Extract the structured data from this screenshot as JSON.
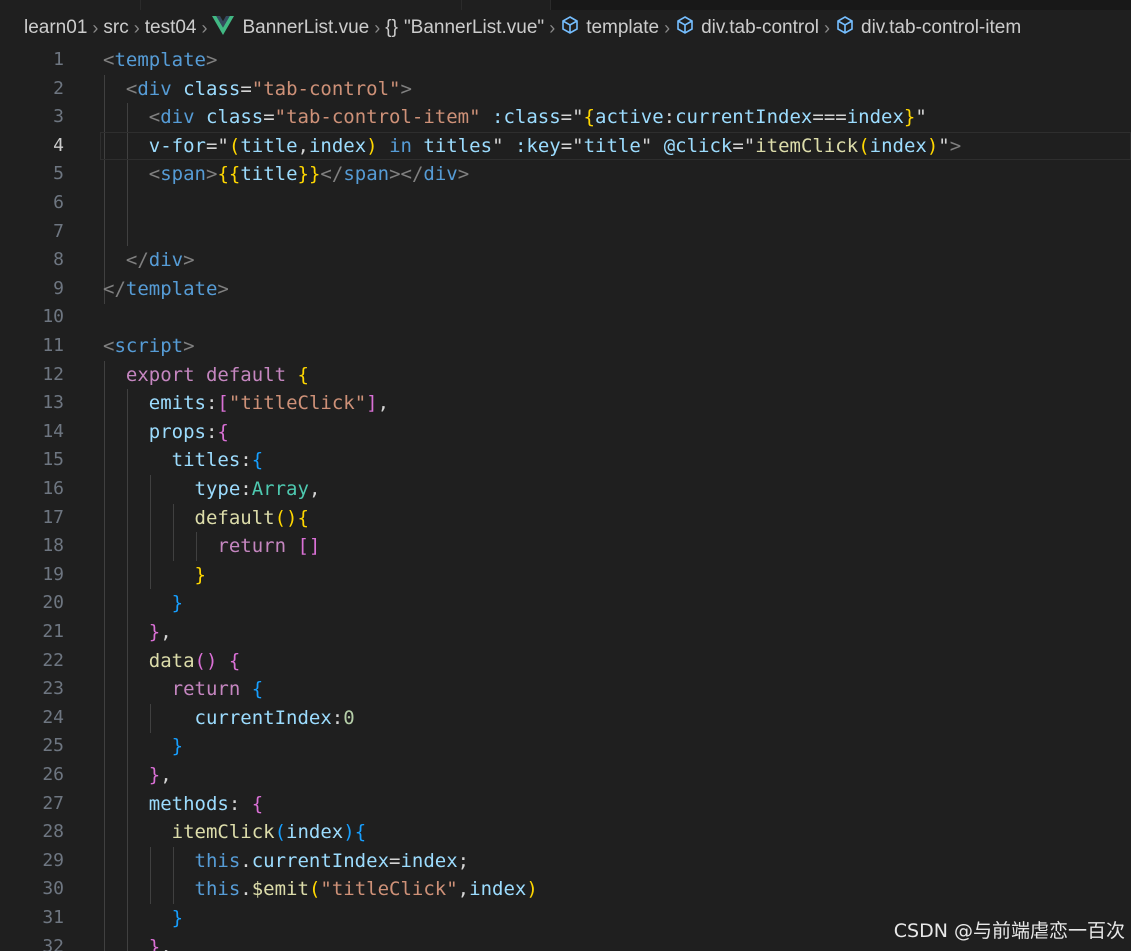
{
  "breadcrumb": {
    "items": [
      {
        "label": "learn01",
        "icon": ""
      },
      {
        "label": "src",
        "icon": ""
      },
      {
        "label": "test04",
        "icon": ""
      },
      {
        "label": "BannerList.vue",
        "icon": "vue-icon"
      },
      {
        "label": "\"BannerList.vue\"",
        "icon": "braces-icon"
      },
      {
        "label": "template",
        "icon": "cube-icon"
      },
      {
        "label": "div.tab-control",
        "icon": "cube-icon"
      },
      {
        "label": "div.tab-control-item",
        "icon": "cube-icon"
      }
    ],
    "vue_color": "#41b883",
    "cube_color": "#75beff"
  },
  "editor": {
    "active_line": 4,
    "lines": [
      {
        "n": "1",
        "tokens": [
          [
            "b",
            "<"
          ],
          [
            "tag",
            "template"
          ],
          [
            "b",
            ">"
          ]
        ]
      },
      {
        "n": "2",
        "tokens": [
          [
            "p",
            "  "
          ],
          [
            "b",
            "<"
          ],
          [
            "tag",
            "div"
          ],
          [
            "p",
            " "
          ],
          [
            "attr",
            "class"
          ],
          [
            "p",
            "="
          ],
          [
            "str",
            "\"tab-control\""
          ],
          [
            "b",
            ">"
          ]
        ]
      },
      {
        "n": "3",
        "tokens": [
          [
            "p",
            "    "
          ],
          [
            "b",
            "<"
          ],
          [
            "tag",
            "div"
          ],
          [
            "p",
            " "
          ],
          [
            "attr",
            "class"
          ],
          [
            "p",
            "="
          ],
          [
            "str",
            "\"tab-control-item\""
          ],
          [
            "p",
            " "
          ],
          [
            "attr",
            ":class"
          ],
          [
            "p",
            "=\""
          ],
          [
            "b1",
            "{"
          ],
          [
            "prop",
            "active"
          ],
          [
            "p",
            ":"
          ],
          [
            "prop",
            "currentIndex"
          ],
          [
            "p",
            "==="
          ],
          [
            "prop",
            "index"
          ],
          [
            "b1",
            "}"
          ],
          [
            "p",
            "\""
          ]
        ]
      },
      {
        "n": "4",
        "tokens": [
          [
            "p",
            "    "
          ],
          [
            "attr",
            "v-for"
          ],
          [
            "p",
            "=\""
          ],
          [
            "b1",
            "("
          ],
          [
            "prop",
            "title"
          ],
          [
            "p",
            ","
          ],
          [
            "prop",
            "index"
          ],
          [
            "b1",
            ")"
          ],
          [
            "p",
            " "
          ],
          [
            "thisvar",
            "in"
          ],
          [
            "p",
            " "
          ],
          [
            "prop",
            "titles"
          ],
          [
            "p",
            "\" "
          ],
          [
            "attr",
            ":key"
          ],
          [
            "p",
            "=\""
          ],
          [
            "prop",
            "title"
          ],
          [
            "p",
            "\" "
          ],
          [
            "attr",
            "@click"
          ],
          [
            "p",
            "=\""
          ],
          [
            "fn",
            "itemClick"
          ],
          [
            "b1",
            "("
          ],
          [
            "prop",
            "index"
          ],
          [
            "b1",
            ")"
          ],
          [
            "p",
            "\""
          ],
          [
            "b",
            ">"
          ]
        ]
      },
      {
        "n": "5",
        "tokens": [
          [
            "p",
            "    "
          ],
          [
            "b",
            "<"
          ],
          [
            "tag",
            "span"
          ],
          [
            "b",
            ">"
          ],
          [
            "b1",
            "{{"
          ],
          [
            "prop",
            "title"
          ],
          [
            "b1",
            "}}"
          ],
          [
            "b",
            "</"
          ],
          [
            "tag",
            "span"
          ],
          [
            "b",
            "></"
          ],
          [
            "tag",
            "div"
          ],
          [
            "b",
            ">"
          ]
        ]
      },
      {
        "n": "6",
        "tokens": []
      },
      {
        "n": "7",
        "tokens": []
      },
      {
        "n": "8",
        "tokens": [
          [
            "p",
            "  "
          ],
          [
            "b",
            "</"
          ],
          [
            "tag",
            "div"
          ],
          [
            "b",
            ">"
          ]
        ]
      },
      {
        "n": "9",
        "tokens": [
          [
            "b",
            "</"
          ],
          [
            "tag",
            "template"
          ],
          [
            "b",
            ">"
          ]
        ]
      },
      {
        "n": "10",
        "tokens": []
      },
      {
        "n": "11",
        "tokens": [
          [
            "b",
            "<"
          ],
          [
            "tag",
            "script"
          ],
          [
            "b",
            ">"
          ]
        ]
      },
      {
        "n": "12",
        "tokens": [
          [
            "p",
            "  "
          ],
          [
            "kw",
            "export"
          ],
          [
            "p",
            " "
          ],
          [
            "kw",
            "default"
          ],
          [
            "p",
            " "
          ],
          [
            "b1",
            "{"
          ]
        ]
      },
      {
        "n": "13",
        "tokens": [
          [
            "p",
            "    "
          ],
          [
            "prop",
            "emits"
          ],
          [
            "p",
            ":"
          ],
          [
            "b2",
            "["
          ],
          [
            "str",
            "\"titleClick\""
          ],
          [
            "b2",
            "]"
          ],
          [
            "p",
            ","
          ]
        ]
      },
      {
        "n": "14",
        "tokens": [
          [
            "p",
            "    "
          ],
          [
            "prop",
            "props"
          ],
          [
            "p",
            ":"
          ],
          [
            "b2",
            "{"
          ]
        ]
      },
      {
        "n": "15",
        "tokens": [
          [
            "p",
            "      "
          ],
          [
            "prop",
            "titles"
          ],
          [
            "p",
            ":"
          ],
          [
            "b3",
            "{"
          ]
        ]
      },
      {
        "n": "16",
        "tokens": [
          [
            "p",
            "        "
          ],
          [
            "prop",
            "type"
          ],
          [
            "p",
            ":"
          ],
          [
            "type",
            "Array"
          ],
          [
            "p",
            ","
          ]
        ]
      },
      {
        "n": "17",
        "tokens": [
          [
            "p",
            "        "
          ],
          [
            "fn",
            "default"
          ],
          [
            "b1",
            "()"
          ],
          [
            "b1",
            "{"
          ]
        ]
      },
      {
        "n": "18",
        "tokens": [
          [
            "p",
            "          "
          ],
          [
            "kw",
            "return"
          ],
          [
            "p",
            " "
          ],
          [
            "b2",
            "[]"
          ]
        ]
      },
      {
        "n": "19",
        "tokens": [
          [
            "p",
            "        "
          ],
          [
            "b1",
            "}"
          ]
        ]
      },
      {
        "n": "20",
        "tokens": [
          [
            "p",
            "      "
          ],
          [
            "b3",
            "}"
          ]
        ]
      },
      {
        "n": "21",
        "tokens": [
          [
            "p",
            "    "
          ],
          [
            "b2",
            "}"
          ],
          [
            "p",
            ","
          ]
        ]
      },
      {
        "n": "22",
        "tokens": [
          [
            "p",
            "    "
          ],
          [
            "fn",
            "data"
          ],
          [
            "b2",
            "()"
          ],
          [
            "p",
            " "
          ],
          [
            "b2",
            "{"
          ]
        ]
      },
      {
        "n": "23",
        "tokens": [
          [
            "p",
            "      "
          ],
          [
            "kw",
            "return"
          ],
          [
            "p",
            " "
          ],
          [
            "b3",
            "{"
          ]
        ]
      },
      {
        "n": "24",
        "tokens": [
          [
            "p",
            "        "
          ],
          [
            "prop",
            "currentIndex"
          ],
          [
            "p",
            ":"
          ],
          [
            "num",
            "0"
          ]
        ]
      },
      {
        "n": "25",
        "tokens": [
          [
            "p",
            "      "
          ],
          [
            "b3",
            "}"
          ]
        ]
      },
      {
        "n": "26",
        "tokens": [
          [
            "p",
            "    "
          ],
          [
            "b2",
            "}"
          ],
          [
            "p",
            ","
          ]
        ]
      },
      {
        "n": "27",
        "tokens": [
          [
            "p",
            "    "
          ],
          [
            "prop",
            "methods"
          ],
          [
            "p",
            ": "
          ],
          [
            "b2",
            "{"
          ]
        ]
      },
      {
        "n": "28",
        "tokens": [
          [
            "p",
            "      "
          ],
          [
            "fn",
            "itemClick"
          ],
          [
            "b3",
            "("
          ],
          [
            "prop",
            "index"
          ],
          [
            "b3",
            ")"
          ],
          [
            "b3",
            "{"
          ]
        ]
      },
      {
        "n": "29",
        "tokens": [
          [
            "p",
            "        "
          ],
          [
            "thisvar",
            "this"
          ],
          [
            "p",
            "."
          ],
          [
            "prop",
            "currentIndex"
          ],
          [
            "p",
            "="
          ],
          [
            "prop",
            "index"
          ],
          [
            "p",
            ";"
          ]
        ]
      },
      {
        "n": "30",
        "tokens": [
          [
            "p",
            "        "
          ],
          [
            "thisvar",
            "this"
          ],
          [
            "p",
            "."
          ],
          [
            "fn",
            "$emit"
          ],
          [
            "b1",
            "("
          ],
          [
            "str",
            "\"titleClick\""
          ],
          [
            "p",
            ","
          ],
          [
            "prop",
            "index"
          ],
          [
            "b1",
            ")"
          ]
        ]
      },
      {
        "n": "31",
        "tokens": [
          [
            "p",
            "      "
          ],
          [
            "b3",
            "}"
          ]
        ]
      },
      {
        "n": "32",
        "tokens": [
          [
            "p",
            "    "
          ],
          [
            "b2",
            "}"
          ],
          [
            "p",
            ","
          ]
        ]
      }
    ]
  },
  "watermark": "CSDN @与前端虐恋一百次"
}
